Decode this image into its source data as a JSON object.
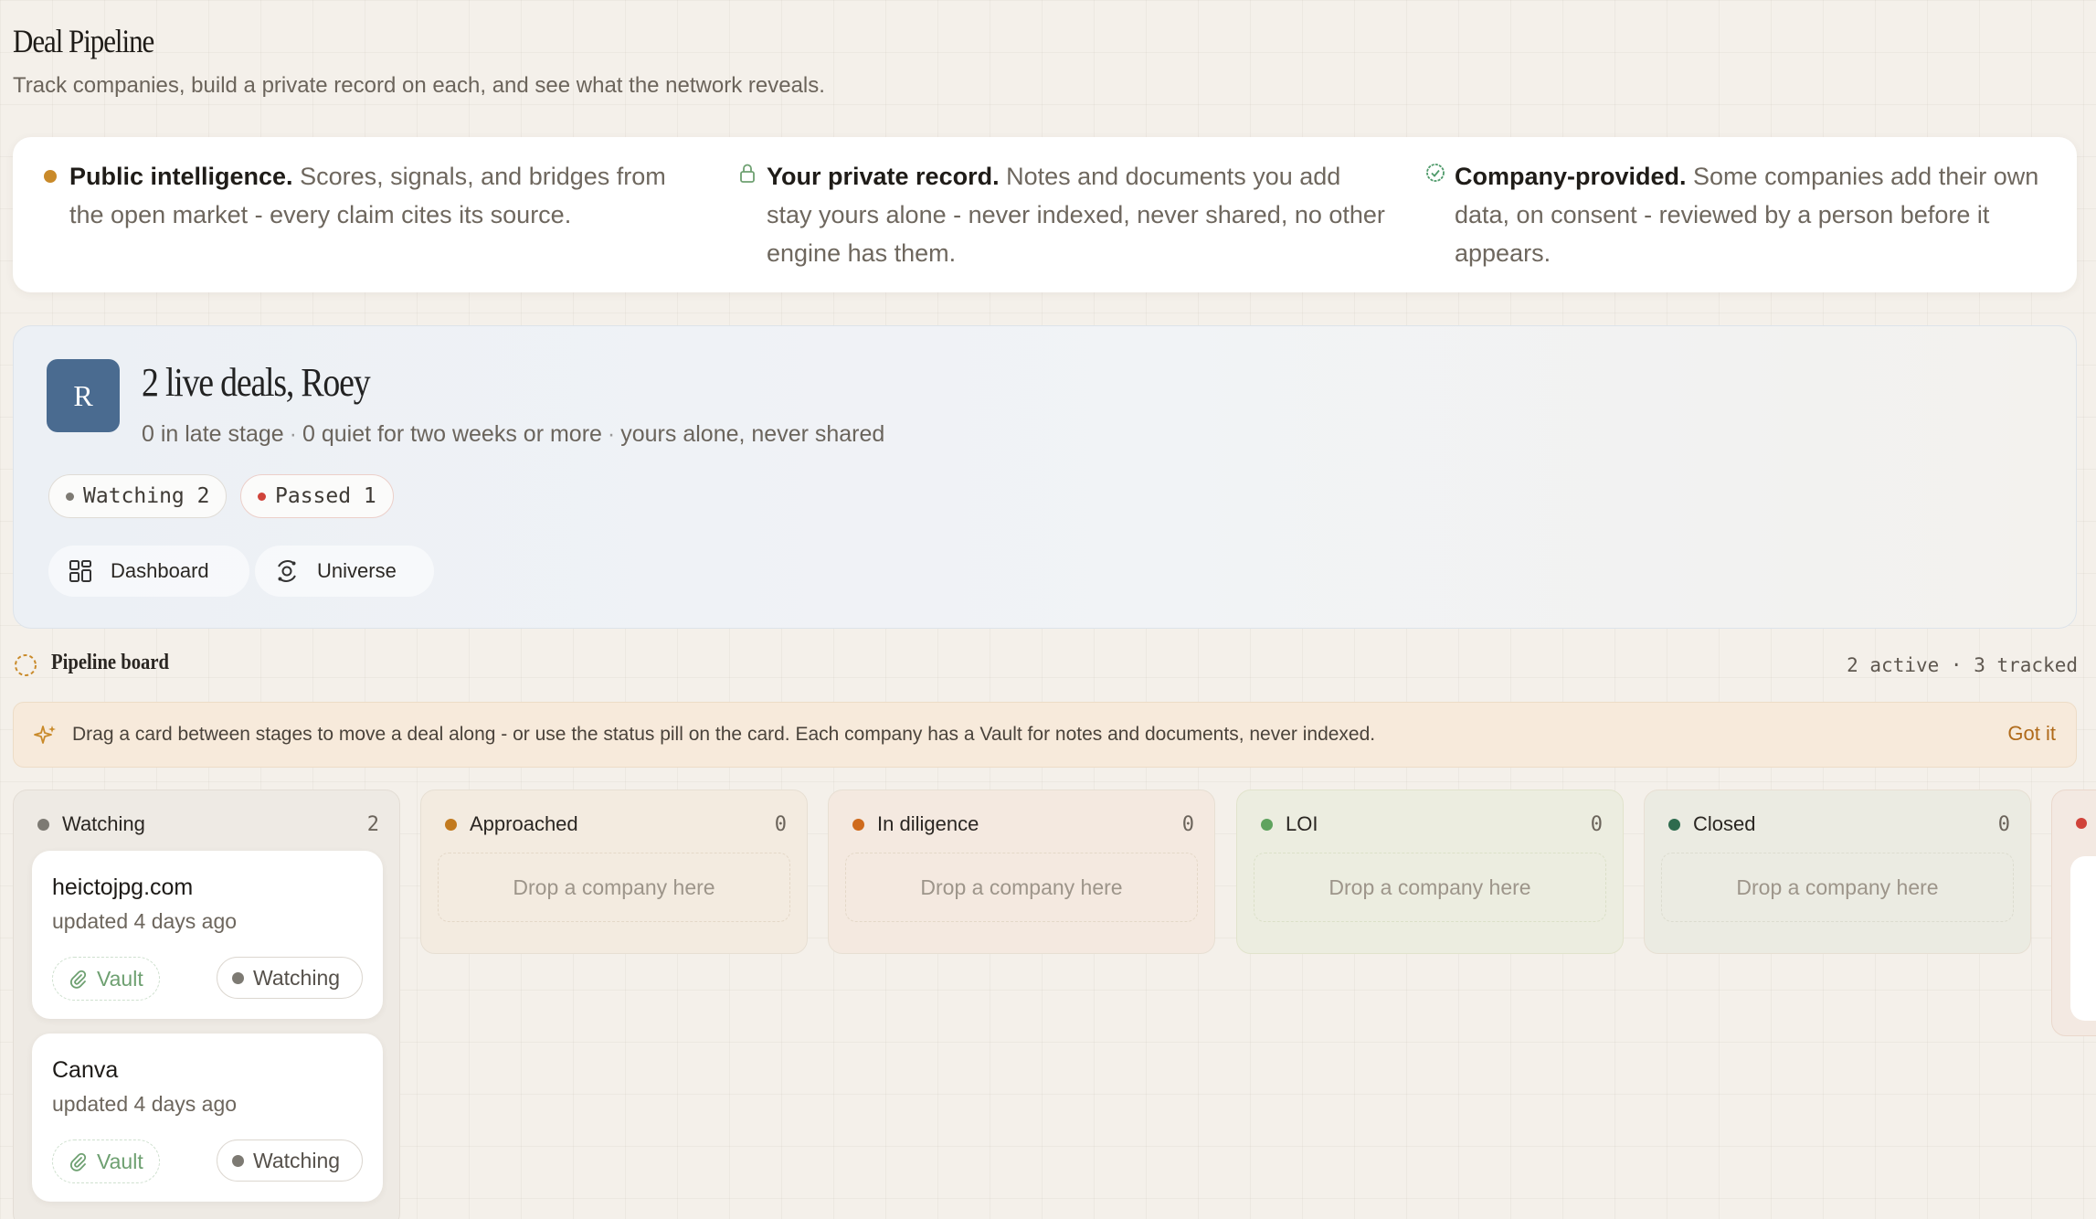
{
  "header": {
    "title": "Deal Pipeline",
    "subtitle": "Track companies, build a private record on each, and see what the network reveals."
  },
  "info": [
    {
      "icon": "amber-dot-icon",
      "title": "Public intelligence.",
      "text": " Scores, signals, and bridges from the open market - every claim cites its source."
    },
    {
      "icon": "lock-icon",
      "title": "Your private record.",
      "text": " Notes and documents you add stay yours alone - never indexed, never shared, no other engine has them."
    },
    {
      "icon": "check-badge-icon",
      "title": "Company-provided.",
      "text": " Some companies add their own data, on consent - reviewed by a person before it appears."
    }
  ],
  "summary": {
    "avatar_initial": "R",
    "title": "2 live deals, Roey",
    "late_stage": "0 in late stage",
    "quiet": "0 quiet for two weeks or more",
    "private_note": "yours alone, never shared",
    "separator": "·",
    "pills": [
      {
        "label": "Watching 2",
        "color": "#7d7a73"
      },
      {
        "label": "Passed 1",
        "color": "#d0433a"
      }
    ],
    "nav": [
      {
        "label": "Dashboard",
        "icon": "grid-icon"
      },
      {
        "label": "Universe",
        "icon": "orbit-icon"
      }
    ]
  },
  "board": {
    "title": "Pipeline board",
    "count": "2 active · 3 tracked"
  },
  "tip": {
    "text": "Drag a card between stages to move a deal along - or use the status pill on the card. Each company has a Vault for notes and documents, never indexed.",
    "action": "Got it"
  },
  "columns": [
    {
      "label": "Watching",
      "count": "2",
      "color": "#7d7a73"
    },
    {
      "label": "Approached",
      "count": "0",
      "color": "#c27a1e"
    },
    {
      "label": "In diligence",
      "count": "0",
      "color": "#cf6a1c"
    },
    {
      "label": "LOI",
      "count": "0",
      "color": "#5fa35e"
    },
    {
      "label": "Closed",
      "count": "0",
      "color": "#2e6b4e"
    }
  ],
  "drop_placeholder": "Drop a company here",
  "deals": [
    {
      "name": "heictojpg.com",
      "updated": "updated 4 days ago",
      "vault": "Vault",
      "status": "Watching"
    },
    {
      "name": "Canva",
      "updated": "updated 4 days ago",
      "vault": "Vault",
      "status": "Watching"
    }
  ]
}
